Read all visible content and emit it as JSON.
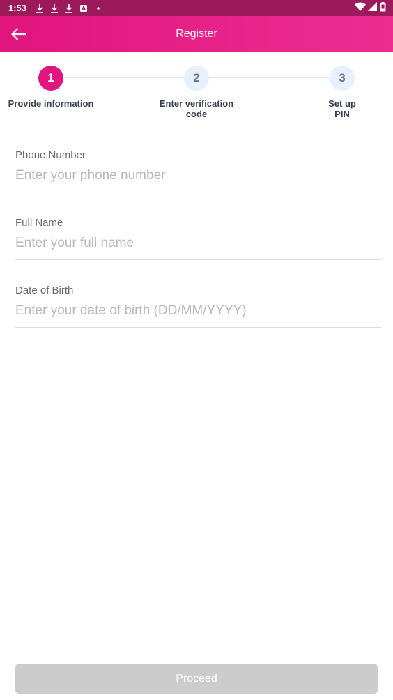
{
  "status_bar": {
    "time": "1:53",
    "left_icons": [
      "download-icon",
      "download-icon",
      "download-icon",
      "a-icon",
      "dot-icon"
    ],
    "right_icons": [
      "wifi-icon",
      "signal-icon",
      "battery-icon"
    ]
  },
  "app_bar": {
    "title": "Register",
    "back_icon": "arrow-left-icon"
  },
  "stepper": {
    "steps": [
      {
        "number": "1",
        "label": "Provide information",
        "active": true
      },
      {
        "number": "2",
        "label": "Enter verification code",
        "active": false
      },
      {
        "number": "3",
        "label": "Set up PIN",
        "active": false
      }
    ]
  },
  "form": {
    "phone": {
      "label": "Phone Number",
      "placeholder": "Enter your phone number",
      "value": ""
    },
    "full_name": {
      "label": "Full Name",
      "placeholder": "Enter your full name",
      "value": ""
    },
    "dob": {
      "label": "Date of Birth",
      "placeholder": "Enter your date of birth (DD/MM/YYYY)",
      "value": ""
    }
  },
  "proceed_label": "Proceed",
  "colors": {
    "brand": "#e0157d",
    "status_bar": "#9c1a5b",
    "button_disabled": "#cccccc"
  }
}
